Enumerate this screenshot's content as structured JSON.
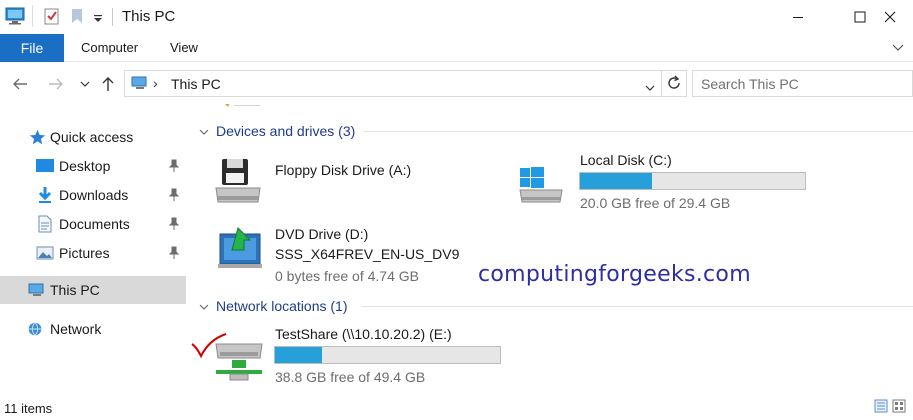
{
  "window": {
    "title": "This PC",
    "minimize_label": "—",
    "maximize_label": "☐",
    "close_label": "✕"
  },
  "ribbon": {
    "tabs": [
      {
        "label": "File"
      },
      {
        "label": "Computer"
      },
      {
        "label": "View"
      }
    ]
  },
  "address": {
    "location": "This PC",
    "separator": "›"
  },
  "search": {
    "placeholder": "Search This PC"
  },
  "sidebar": {
    "items": [
      {
        "label": "Quick access",
        "icon": "star-icon"
      },
      {
        "label": "Desktop",
        "icon": "desktop-folder-icon"
      },
      {
        "label": "Downloads",
        "icon": "downloads-folder-icon"
      },
      {
        "label": "Documents",
        "icon": "documents-folder-icon"
      },
      {
        "label": "Pictures",
        "icon": "pictures-folder-icon"
      },
      {
        "label": "This PC",
        "icon": "computer-icon"
      },
      {
        "label": "Network",
        "icon": "network-icon"
      }
    ]
  },
  "groups": {
    "devices": {
      "label": "Devices and drives (3)"
    },
    "network": {
      "label": "Network locations (1)"
    }
  },
  "drives": {
    "floppy": {
      "name": "Floppy Disk Drive (A:)",
      "icon": "floppy-drive-icon"
    },
    "local_c": {
      "name": "Local Disk (C:)",
      "free": "20.0 GB free of 29.4 GB",
      "used_fraction": 0.32,
      "icon": "windows-drive-icon"
    },
    "dvd": {
      "name": "DVD Drive (D:)",
      "volume": "SSS_X64FREV_EN-US_DV9",
      "free": "0 bytes free of 4.74 GB",
      "icon": "dvd-drive-icon"
    },
    "share": {
      "name": "TestShare (\\\\10.10.20.2) (E:)",
      "free": "38.8 GB free of 49.4 GB",
      "used_fraction": 0.21,
      "icon": "network-drive-icon"
    }
  },
  "watermark": {
    "text": "computingforgeeks.com"
  },
  "status": {
    "items_count": "11 items"
  },
  "colors": {
    "accent": "#1a6fc4",
    "bar_fill": "#26a0da",
    "group_header": "#1e3c8c",
    "selected": "#d9d9d9",
    "checkmark": "#d40000"
  }
}
